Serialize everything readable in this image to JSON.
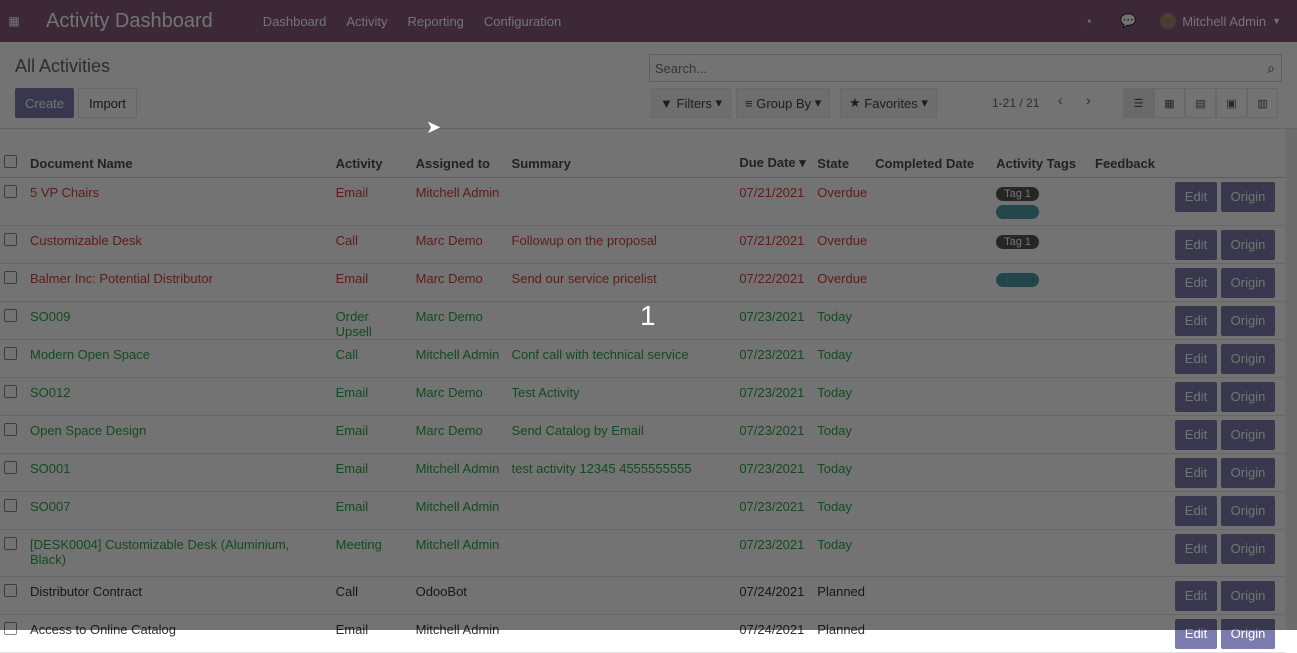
{
  "navbar": {
    "app_name": "Activity Dashboard",
    "menu": [
      "Dashboard",
      "Activity",
      "Reporting",
      "Configuration"
    ],
    "user": "Mitchell Admin"
  },
  "page": {
    "title": "All Activities",
    "create": "Create",
    "import": "Import"
  },
  "search": {
    "placeholder": "Search..."
  },
  "filters": {
    "filters": "Filters",
    "group_by": "Group By",
    "favorites": "Favorites"
  },
  "pager": {
    "text": "1-21 / 21"
  },
  "columns": [
    "Document Name",
    "Activity",
    "Assigned to",
    "Summary",
    "Due Date",
    "State",
    "Completed Date",
    "Activity Tags",
    "Feedback"
  ],
  "rows": [
    {
      "doc": "5 VP Chairs",
      "activity": "Email",
      "assigned": "Mitchell Admin",
      "summary": "",
      "due": "07/21/2021",
      "state": "Overdue",
      "tags": [
        "Tag 1",
        "Tag 2"
      ]
    },
    {
      "doc": "Customizable Desk",
      "activity": "Call",
      "assigned": "Marc Demo",
      "summary": "Followup on the proposal",
      "due": "07/21/2021",
      "state": "Overdue",
      "tags": [
        "Tag 1"
      ]
    },
    {
      "doc": "Balmer Inc: Potential Distributor",
      "activity": "Email",
      "assigned": "Marc Demo",
      "summary": "Send our service pricelist",
      "due": "07/22/2021",
      "state": "Overdue",
      "tags": [
        "Tag 2"
      ]
    },
    {
      "doc": "SO009",
      "activity": "Order Upsell",
      "assigned": "Marc Demo",
      "summary": "",
      "due": "07/23/2021",
      "state": "Today",
      "tags": []
    },
    {
      "doc": "Modern Open Space",
      "activity": "Call",
      "assigned": "Mitchell Admin",
      "summary": "Conf call with technical service",
      "due": "07/23/2021",
      "state": "Today",
      "tags": []
    },
    {
      "doc": "SO012",
      "activity": "Email",
      "assigned": "Marc Demo",
      "summary": "Test Activity",
      "due": "07/23/2021",
      "state": "Today",
      "tags": []
    },
    {
      "doc": "Open Space Design",
      "activity": "Email",
      "assigned": "Marc Demo",
      "summary": "Send Catalog by Email",
      "due": "07/23/2021",
      "state": "Today",
      "tags": []
    },
    {
      "doc": "SO001",
      "activity": "Email",
      "assigned": "Mitchell Admin",
      "summary": "test activity 12345 4555555555",
      "due": "07/23/2021",
      "state": "Today",
      "tags": []
    },
    {
      "doc": "SO007",
      "activity": "Email",
      "assigned": "Mitchell Admin",
      "summary": "",
      "due": "07/23/2021",
      "state": "Today",
      "tags": []
    },
    {
      "doc": "[DESK0004] Customizable Desk (Aluminium, Black)",
      "activity": "Meeting",
      "assigned": "Mitchell Admin",
      "summary": "",
      "due": "07/23/2021",
      "state": "Today",
      "tags": []
    },
    {
      "doc": "Distributor Contract",
      "activity": "Call",
      "assigned": "OdooBot",
      "summary": "",
      "due": "07/24/2021",
      "state": "Planned",
      "tags": []
    },
    {
      "doc": "Access to Online Catalog",
      "activity": "Email",
      "assigned": "Mitchell Admin",
      "summary": "",
      "due": "07/24/2021",
      "state": "Planned",
      "tags": []
    }
  ],
  "row_buttons": {
    "edit": "Edit",
    "origin": "Origin"
  },
  "overlay": {
    "counter": "1"
  }
}
